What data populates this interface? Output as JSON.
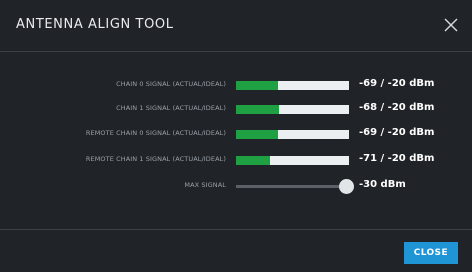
{
  "dialog": {
    "title": "ANTENNA ALIGN TOOL",
    "close_icon": "close-icon"
  },
  "signals": [
    {
      "label": "CHAIN 0 SIGNAL (ACTUAL/IDEAL)",
      "value": "-69 / -20 dBm",
      "fill_fraction": 0.37
    },
    {
      "label": "CHAIN 1 SIGNAL (ACTUAL/IDEAL)",
      "value": "-68 / -20 dBm",
      "fill_fraction": 0.38
    },
    {
      "label": "REMOTE CHAIN 0 SIGNAL (ACTUAL/IDEAL)",
      "value": "-69 / -20 dBm",
      "fill_fraction": 0.37
    },
    {
      "label": "REMOTE CHAIN 1 SIGNAL (ACTUAL/IDEAL)",
      "value": "-71 / -20 dBm",
      "fill_fraction": 0.3
    }
  ],
  "max_signal": {
    "label": "MAX SIGNAL",
    "value": "-30 dBm",
    "slider_fraction": 0.98
  },
  "footer": {
    "close_label": "CLOSE"
  },
  "colors": {
    "background": "#202327",
    "signal_fill": "#1fa043",
    "bar_background": "#eceff1",
    "button": "#1f95d6"
  }
}
